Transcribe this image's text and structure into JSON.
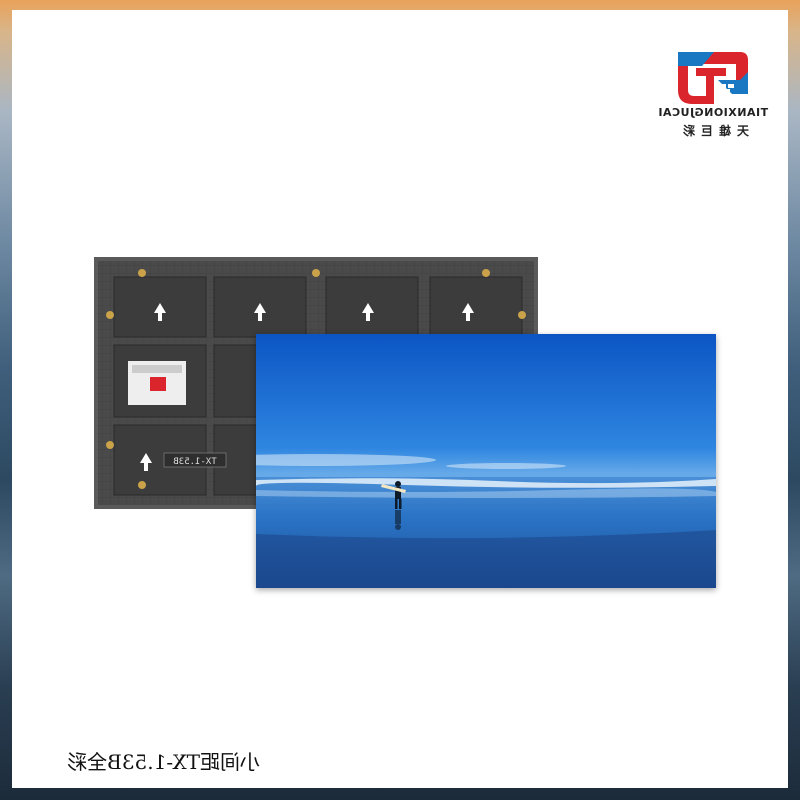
{
  "brand": {
    "name_en": "TIANXIONGJUCAI",
    "name_cn": "天雄巨彩",
    "colors": {
      "red": "#d9252b",
      "blue": "#1a78c2"
    }
  },
  "product": {
    "caption": "小间距TX-1.53B全彩",
    "module_label": "TX-1.53B"
  },
  "images": {
    "back_module": "led-module-rear-view",
    "front_module": "beach-surfer-display-image"
  }
}
